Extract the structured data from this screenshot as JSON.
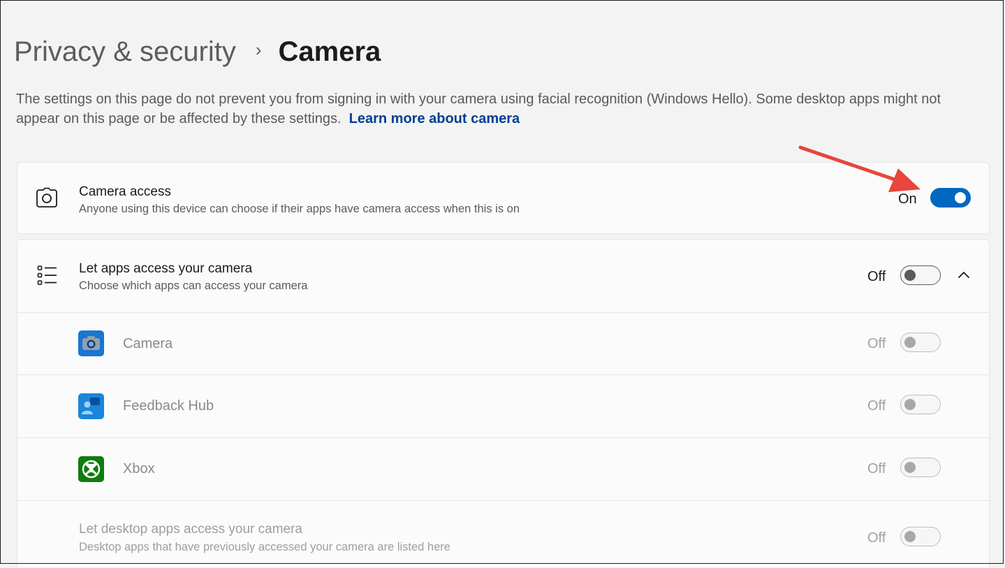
{
  "breadcrumb": {
    "parent": "Privacy & security",
    "separator": "›",
    "current": "Camera"
  },
  "description": {
    "text": "The settings on this page do not prevent you from signing in with your camera using facial recognition (Windows Hello). Some desktop apps might not appear on this page or be affected by these settings.",
    "link": "Learn more about camera"
  },
  "camera_access": {
    "title": "Camera access",
    "subtitle": "Anyone using this device can choose if their apps have camera access when this is on",
    "state_label": "On",
    "icon": "camera-icon"
  },
  "apps_access": {
    "title": "Let apps access your camera",
    "subtitle": "Choose which apps can access your camera",
    "state_label": "Off",
    "icon": "list-icon",
    "apps": [
      {
        "name": "Camera",
        "state_label": "Off",
        "icon": "camera-app-icon"
      },
      {
        "name": "Feedback Hub",
        "state_label": "Off",
        "icon": "feedback-hub-icon"
      },
      {
        "name": "Xbox",
        "state_label": "Off",
        "icon": "xbox-icon"
      }
    ]
  },
  "desktop_apps": {
    "title": "Let desktop apps access your camera",
    "subtitle": "Desktop apps that have previously accessed your camera are listed here",
    "state_label": "Off"
  },
  "colors": {
    "accent": "#0067c0",
    "link": "#003e92",
    "annotation_arrow": "#e8453c"
  }
}
